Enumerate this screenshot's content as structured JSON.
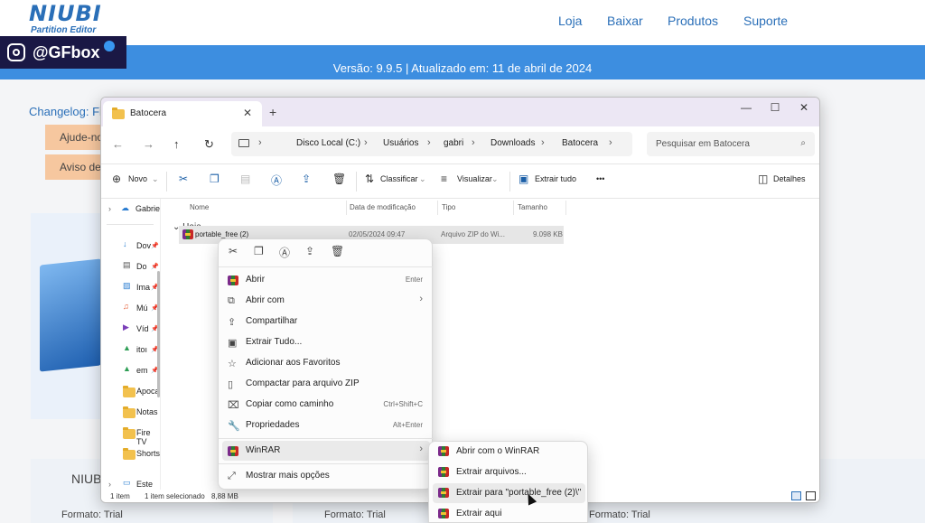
{
  "site": {
    "logo_line1": "NIUBI",
    "logo_line2": "Partition Editor",
    "nav": [
      "Loja",
      "Baixar",
      "Produtos",
      "Suporte"
    ],
    "banner": "Versão: 9.9.5 | Atualizado em: 11 de abril de 2024",
    "changelog": "Changelog: Fin",
    "buttons": [
      "Ajude-no",
      "Aviso de"
    ],
    "product_name": "NIUBI",
    "formato": [
      "Formato: Trial",
      "Formato: Trial",
      "Formato: Trial"
    ],
    "accent": "#3d8ee0"
  },
  "watermark": {
    "handle": "@GFbox"
  },
  "window": {
    "tab_title": "Batocera",
    "controls": [
      "—",
      "☐",
      "✕"
    ],
    "breadcrumb": [
      "Disco Local (C:)",
      "Usuários",
      "gabri",
      "Downloads",
      "Batocera"
    ],
    "search_placeholder": "Pesquisar em Batocera",
    "toolbar": {
      "new": "Novo",
      "sort": "Classificar",
      "view": "Visualizar",
      "extract_all": "Extrair tudo",
      "more": "•••",
      "details": "Detalhes"
    },
    "nav_pane": {
      "top_item": "Gabrie",
      "items": [
        {
          "label": "Dov",
          "icon": "download-icon"
        },
        {
          "label": "Do",
          "icon": "document-icon"
        },
        {
          "label": "Ima",
          "icon": "image-icon"
        },
        {
          "label": "Mú",
          "icon": "music-icon"
        },
        {
          "label": "Víd",
          "icon": "video-icon"
        },
        {
          "label": "itoı",
          "icon": "drive-icon"
        },
        {
          "label": "em",
          "icon": "drive-icon"
        },
        {
          "label": "Apoca",
          "icon": "folder-icon"
        },
        {
          "label": "Notas",
          "icon": "folder-icon"
        },
        {
          "label": "Fire TV",
          "icon": "folder-icon"
        },
        {
          "label": "Shorts",
          "icon": "folder-icon"
        },
        {
          "label": "Este C",
          "icon": "pc-icon"
        }
      ]
    },
    "columns": [
      "Nome",
      "Data de modificação",
      "Tipo",
      "Tamanho"
    ],
    "group": "Hoje",
    "file": {
      "name": "portable_free (2)",
      "date": "02/05/2024 09:47",
      "type": "Arquivo ZIP do Wi...",
      "size": "9.098 KB"
    },
    "status": [
      "1 item",
      "1 item selecionado",
      "8,88 MB"
    ]
  },
  "context_menu": {
    "top_icons": [
      "cut-icon",
      "copy-icon",
      "rename-icon",
      "share-icon",
      "delete-icon"
    ],
    "items": [
      {
        "label": "Abrir",
        "shortcut": "Enter",
        "icon": "winrar-icon"
      },
      {
        "label": "Abrir com",
        "shortcut": "›",
        "icon": "open-with-icon"
      },
      {
        "label": "Compartilhar",
        "shortcut": "",
        "icon": "share-icon"
      },
      {
        "label": "Extrair Tudo...",
        "shortcut": "",
        "icon": "extract-icon"
      },
      {
        "label": "Adicionar aos Favoritos",
        "shortcut": "",
        "icon": "star-icon"
      },
      {
        "label": "Compactar para arquivo ZIP",
        "shortcut": "",
        "icon": "zip-icon"
      },
      {
        "label": "Copiar como caminho",
        "shortcut": "Ctrl+Shift+C",
        "icon": "path-icon"
      },
      {
        "label": "Propriedades",
        "shortcut": "Alt+Enter",
        "icon": "wrench-icon"
      },
      {
        "label": "WinRAR",
        "shortcut": "›",
        "icon": "winrar-icon"
      },
      {
        "label": "Mostrar mais opções",
        "shortcut": "",
        "icon": "more-options-icon"
      }
    ]
  },
  "submenu": {
    "items": [
      "Abrir com o WinRAR",
      "Extrair arquivos...",
      "Extrair para \"portable_free (2)\\\"",
      "Extrair aqui"
    ]
  }
}
